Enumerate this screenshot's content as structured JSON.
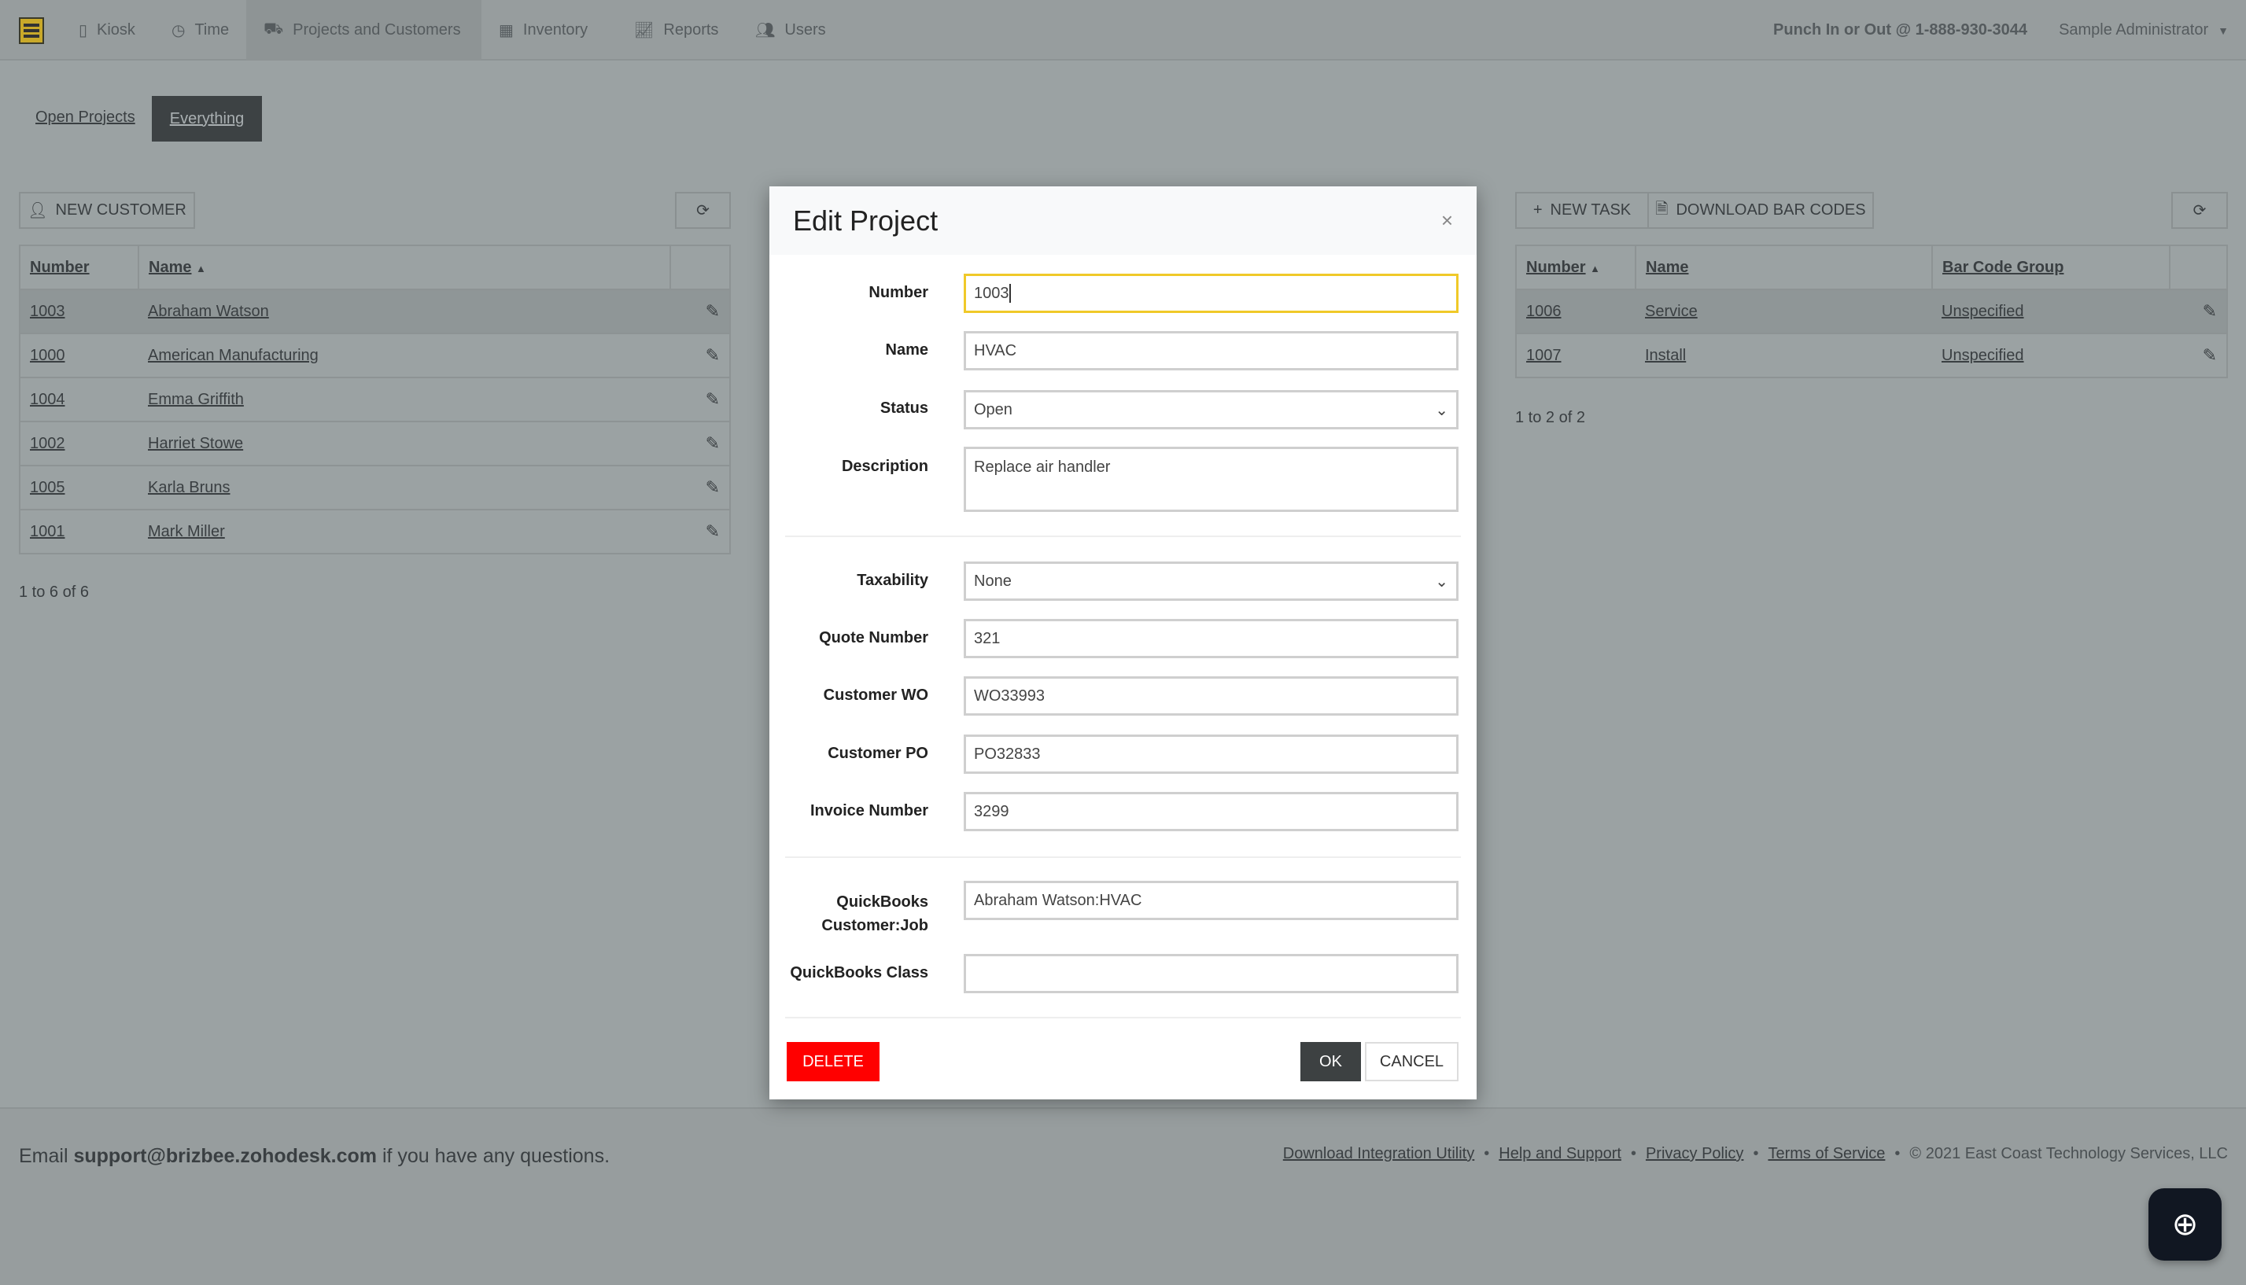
{
  "nav": {
    "items": [
      {
        "label": "Kiosk",
        "icon": "kiosk-icon"
      },
      {
        "label": "Time",
        "icon": "clock-icon"
      },
      {
        "label": "Projects and Customers",
        "icon": "truck-icon",
        "active": true
      },
      {
        "label": "Inventory",
        "icon": "boxes-icon"
      },
      {
        "label": "Reports",
        "icon": "chart-icon"
      },
      {
        "label": "Users",
        "icon": "users-icon"
      }
    ],
    "punch": "Punch In or Out @ 1-888-930-3044",
    "user": "Sample Administrator"
  },
  "tabs": [
    {
      "label": "Open Projects"
    },
    {
      "label": "Everything",
      "active": true
    }
  ],
  "customers": {
    "new_label": "NEW CUSTOMER",
    "headers": [
      "Number",
      "Name"
    ],
    "rows": [
      [
        "1003",
        "Abraham Watson"
      ],
      [
        "1000",
        "American Manufacturing"
      ],
      [
        "1004",
        "Emma Griffith"
      ],
      [
        "1002",
        "Harriet Stowe"
      ],
      [
        "1005",
        "Karla Bruns"
      ],
      [
        "1001",
        "Mark Miller"
      ]
    ],
    "count": "1 to 6 of 6"
  },
  "tasks": {
    "new_label": "NEW TASK",
    "download_label": "DOWNLOAD BAR CODES",
    "headers": [
      "Number",
      "Name",
      "Bar Code Group"
    ],
    "rows": [
      [
        "1006",
        "Service",
        "Unspecified"
      ],
      [
        "1007",
        "Install",
        "Unspecified"
      ]
    ],
    "count": "1 to 2 of 2"
  },
  "modal": {
    "title": "Edit Project",
    "close": "×",
    "fields": {
      "number": {
        "label": "Number",
        "value": "1003"
      },
      "name": {
        "label": "Name",
        "value": "HVAC"
      },
      "status": {
        "label": "Status",
        "value": "Open"
      },
      "description": {
        "label": "Description",
        "value": "Replace air handler"
      },
      "taxability": {
        "label": "Taxability",
        "value": "None"
      },
      "quote": {
        "label": "Quote Number",
        "value": "321"
      },
      "wo": {
        "label": "Customer WO",
        "value": "WO33993"
      },
      "po": {
        "label": "Customer PO",
        "value": "PO32833"
      },
      "invoice": {
        "label": "Invoice Number",
        "value": "3299"
      },
      "qbjob": {
        "label1": "QuickBooks",
        "label2": "Customer:Job",
        "value": "Abraham Watson:HVAC"
      },
      "qbclass": {
        "label": "QuickBooks Class",
        "value": ""
      }
    },
    "delete": "DELETE",
    "ok": "OK",
    "cancel": "CANCEL"
  },
  "footer": {
    "email_pre": "Email ",
    "email": "support@brizbee.zohodesk.com",
    "email_post": " if you have any questions.",
    "links": [
      "Download Integration Utility",
      "Help and Support",
      "Privacy Policy",
      "Terms of Service"
    ],
    "copyright": "© 2021 East Coast Technology Services, LLC"
  },
  "colors": {
    "accent": "#f0c929",
    "delete": "#ff0000",
    "ok": "#3d4142"
  }
}
